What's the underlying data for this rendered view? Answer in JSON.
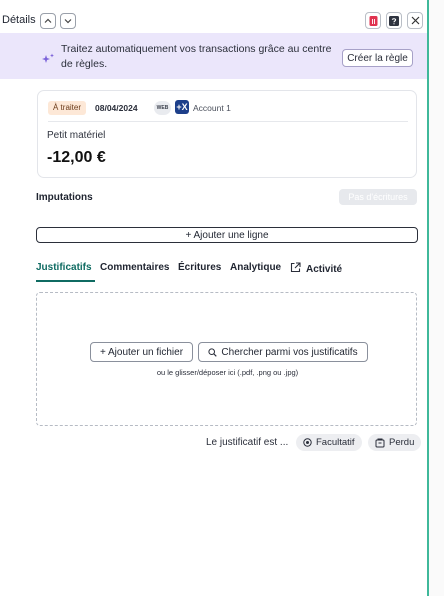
{
  "header": {
    "title": "Détails",
    "icons": {
      "prev": "chevron-up-icon",
      "next": "chevron-down-icon",
      "delete": "trash-icon",
      "help": "help-icon",
      "close": "close-icon"
    },
    "colors": {
      "delete": "#e0324f"
    }
  },
  "banner": {
    "text": "Traitez automatiquement vos transactions grâce au centre de règles.",
    "button": "Créer la règle",
    "icon": "sparkle-icon",
    "bg": "#ebe6fb"
  },
  "transaction": {
    "status": "À traiter",
    "date": "08/04/2024",
    "source_badge": "WEB",
    "account_icon": "+X",
    "account": "Account 1",
    "label": "Petit matériel",
    "amount": "-12,00 €"
  },
  "imputations": {
    "title": "Imputations",
    "badge": "Pas d'écritures",
    "add_line": "+ Ajouter une ligne"
  },
  "tabs": [
    {
      "label": "Justificatifs",
      "active": true
    },
    {
      "label": "Commentaires",
      "active": false
    },
    {
      "label": "Écritures",
      "active": false
    },
    {
      "label": "Analytique",
      "active": false
    },
    {
      "label": "Activité",
      "active": false,
      "icon": "external-link-icon"
    }
  ],
  "dropzone": {
    "add_file": "+ Ajouter un fichier",
    "search": "Chercher parmi vos justificatifs",
    "hint": "ou le glisser/déposer ici (.pdf, .png ou .jpg)"
  },
  "justificatif": {
    "label": "Le justificatif est ...",
    "optional": "Facultatif",
    "lost": "Perdu"
  },
  "accent": "#0f6b62"
}
